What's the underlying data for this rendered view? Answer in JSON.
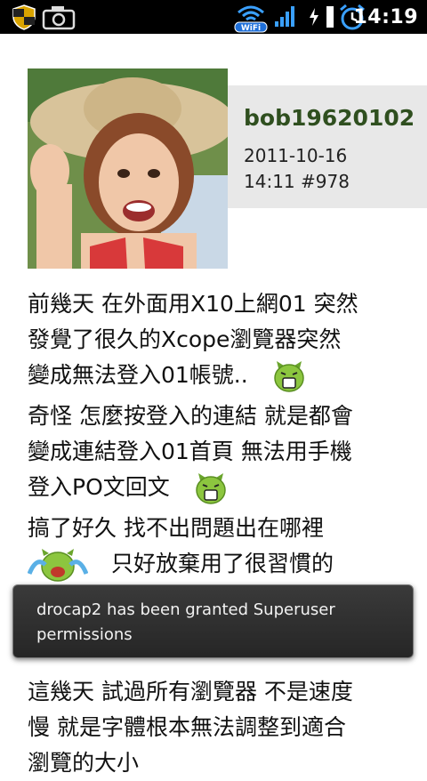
{
  "status_bar": {
    "time": "14:19",
    "wifi_label": "WiFi",
    "icons": [
      "shield-warning-icon",
      "camera-icon",
      "wifi-icon",
      "signal-icon",
      "charging-icon",
      "battery-icon",
      "alarm-clock-icon"
    ]
  },
  "post": {
    "username": "bob19620102",
    "date": "2011-10-16",
    "time_and_number": "14:11  #978",
    "lines": [
      "前幾天 在外面用X10上網01 突然",
      "發覺了很久的Xcope瀏覽器突然",
      "變成無法登入01帳號..",
      "奇怪 怎麼按登入的連結 就是都會",
      "變成連結登入01首頁 無法用手機",
      "登入PO文回文",
      "搞了好久 找不出問題出在哪裡",
      "只好放棄用了很習慣的"
    ],
    "lower_lines": [
      "這幾天 試過所有瀏覽器 不是速度",
      "慢 就是字體根本無法調整到適合",
      "瀏覽的大小"
    ]
  },
  "toast": {
    "message": "drocap2 has been granted Superuser permissions"
  },
  "colors": {
    "status_bar": "#000000",
    "username": "#2f4f1f",
    "meta_box": "#e8e8e8",
    "toast_bg": "#2e2e2e",
    "emoji_green": "#8cc63f"
  }
}
